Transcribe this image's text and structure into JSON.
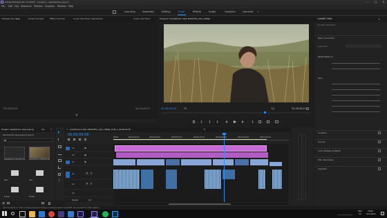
{
  "window": {
    "title": "Adobe Premiere Pro CC 2018 - C:\\Users\\... \\Gentlemen.prproj *"
  },
  "menu": [
    "File",
    "Edit",
    "Clip",
    "Sequence",
    "Markers",
    "Graphics",
    "Window",
    "Help"
  ],
  "workspaces": [
    "Learning",
    "Assembly",
    "Editing",
    "Color",
    "Effects",
    "Audio",
    "Graphics",
    "Libraries"
  ],
  "active_workspace": "Color",
  "source_panel": {
    "tabs": [
      "Source: (no clips)",
      "Lumetri Scopes",
      "Effect Controls",
      "Audio Clip Mixer: Gentlemen",
      "Audio Clip Mixer"
    ],
    "timecode_left": "00;00;00;00",
    "timecode_right": "00;00;00;00"
  },
  "program_panel": {
    "tab": "Program: Gentlemen-clip1-3DOUTbx_Clip_1080p",
    "timecode": "00;06;09;08",
    "fit": "Fit",
    "quality": "1/2",
    "duration": "00;08;06;20"
  },
  "lumetri": {
    "tab": "Lumetri Color",
    "clip_label": "(no clip selected)",
    "sections": [
      "Basic Correction",
      "Input LUT",
      "White Balance",
      "Tone",
      "Creative",
      "Curves",
      "Color Wheels & Match",
      "HSL Secondary",
      "Vignette"
    ]
  },
  "project_panel": {
    "tabs": [
      "Project: Gentlemen (sub.prproj)",
      "Me"
    ],
    "file": "Gentlemen (sub.prproj).prproj",
    "items": [
      {
        "name": "Gentlemen-clip1...",
        "meta": "6:01:19"
      },
      {
        "name": "Gentlemen-clip1...",
        "meta": "8:06:20"
      },
      {
        "name": "Bins",
        "meta": ""
      },
      {
        "name": "Sub",
        "meta": ""
      },
      {
        "name": "Folder",
        "meta": ""
      },
      {
        "name": "Folder",
        "meta": ""
      }
    ]
  },
  "timeline": {
    "tab": "Gentlemen-clip1-3DOUTbx_Clip_1080p_CLIP_1_SC26-0176",
    "timecode": "00;06;09;08",
    "ruler": [
      "00;00",
      "00;05;04;22",
      "00;05;29;24",
      "00;05;54;17",
      "00;06;19;19",
      "00;06;44;16",
      "00;07;09;18",
      "00;07;34;15"
    ],
    "video_tracks": [
      "V3",
      "V2",
      "V1"
    ],
    "audio_tracks": [
      "A1",
      "A2",
      "A3"
    ],
    "master": "Master",
    "master_value": "0.0"
  },
  "status": {
    "text": "Click to select, or click in empty space and drag to marquee select. Use Shift, Alt, and Ctrl for other options."
  },
  "taskbar": {
    "lang1": "ENG",
    "lang2": "US",
    "time": "18:05",
    "date": "16-6-2018"
  },
  "colors": {
    "accent": "#2d8ceb",
    "clip_pink": "#c66ad6",
    "clip_blue": "#8aa6d6",
    "audio": "#3f6fa3"
  }
}
